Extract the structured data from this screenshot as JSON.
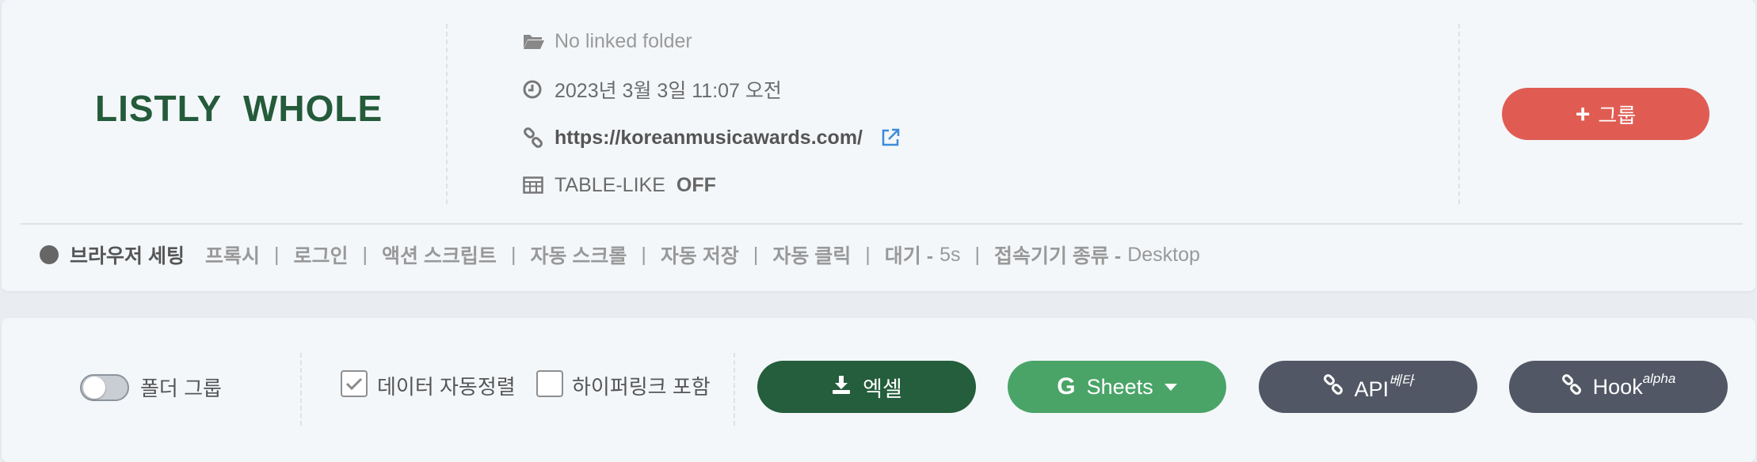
{
  "header": {
    "title": "LISTLY  WHOLE",
    "folder": "No linked folder",
    "datetime": "2023년 3월 3일 11:07 오전",
    "url": "https://koreanmusicawards.com/",
    "table_like_label": "TABLE-LIKE",
    "table_like_value": "OFF",
    "group_button": "그룹"
  },
  "settings": {
    "main_label": "브라우저 세팅",
    "items": [
      "프록시",
      "로그인",
      "액션 스크립트",
      "자동 스크롤",
      "자동 저장",
      "자동 클릭"
    ],
    "wait_label": "대기 -",
    "wait_value": "5s",
    "device_label": "접속기기 종류 -",
    "device_value": "Desktop",
    "separator": "|"
  },
  "bottom": {
    "folder_group_label": "폴더 그룹",
    "auto_sort_label": "데이터 자동정렬",
    "auto_sort_checked": true,
    "hyperlink_label": "하이퍼링크 포함",
    "hyperlink_checked": false,
    "excel_button": "엑셀",
    "sheets_button": "Sheets",
    "api_button": "API",
    "api_badge": "베타",
    "hook_button": "Hook",
    "hook_badge": "alpha"
  },
  "colors": {
    "title_green": "#245b3a",
    "group_red": "#e05c53",
    "excel_green": "#245e3c",
    "sheets_green": "#4aa468",
    "slate": "#525765",
    "link_blue": "#3d8bd9"
  },
  "icons": [
    "folder-open-icon",
    "clock-icon",
    "link-icon",
    "external-link-icon",
    "table-icon",
    "plus-icon",
    "download-icon",
    "google-icon",
    "caret-down-icon"
  ]
}
